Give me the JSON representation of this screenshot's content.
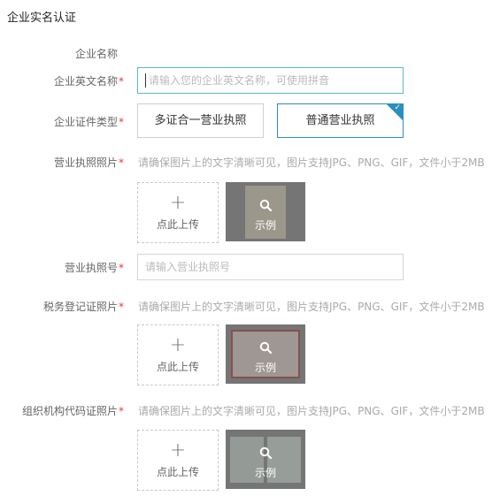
{
  "page": {
    "title": "企业实名认证"
  },
  "fields": {
    "company_name": {
      "label": "企业名称"
    },
    "english_name": {
      "label": "企业英文名称",
      "required": "*",
      "placeholder": "请输入您的企业英文名称，可使用拼音"
    },
    "cert_type": {
      "label": "企业证件类型",
      "required": "*",
      "options": [
        "多证合一营业执照",
        "普通营业执照"
      ],
      "selected": "普通营业执照"
    },
    "license_photo": {
      "label": "营业执照照片",
      "required": "*",
      "hint": "请确保图片上的文字清晰可见，图片支持JPG、PNG、GIF，文件小于2MB",
      "upload_label": "点此上传",
      "example_label": "示例"
    },
    "license_no": {
      "label": "营业执照号",
      "required": "*",
      "placeholder": "请输入营业执照号"
    },
    "tax_photo": {
      "label": "税务登记证照片",
      "required": "*",
      "hint": "请确保图片上的文字清晰可见，图片支持JPG、PNG、GIF，文件小于2MB",
      "upload_label": "点此上传",
      "example_label": "示例"
    },
    "org_code_photo": {
      "label": "组织机构代码证照片",
      "required": "*",
      "hint": "请确保图片上的文字清晰可见，图片支持JPG、PNG、GIF，文件小于2MB",
      "upload_label": "点此上传",
      "example_label": "示例"
    }
  },
  "icons": {
    "upload": "plus-icon",
    "example": "search-icon",
    "selected": "check-corner-icon"
  },
  "colors": {
    "accent": "#2a8fbd",
    "required": "#e4393c",
    "focus": "#5bb5d8"
  }
}
